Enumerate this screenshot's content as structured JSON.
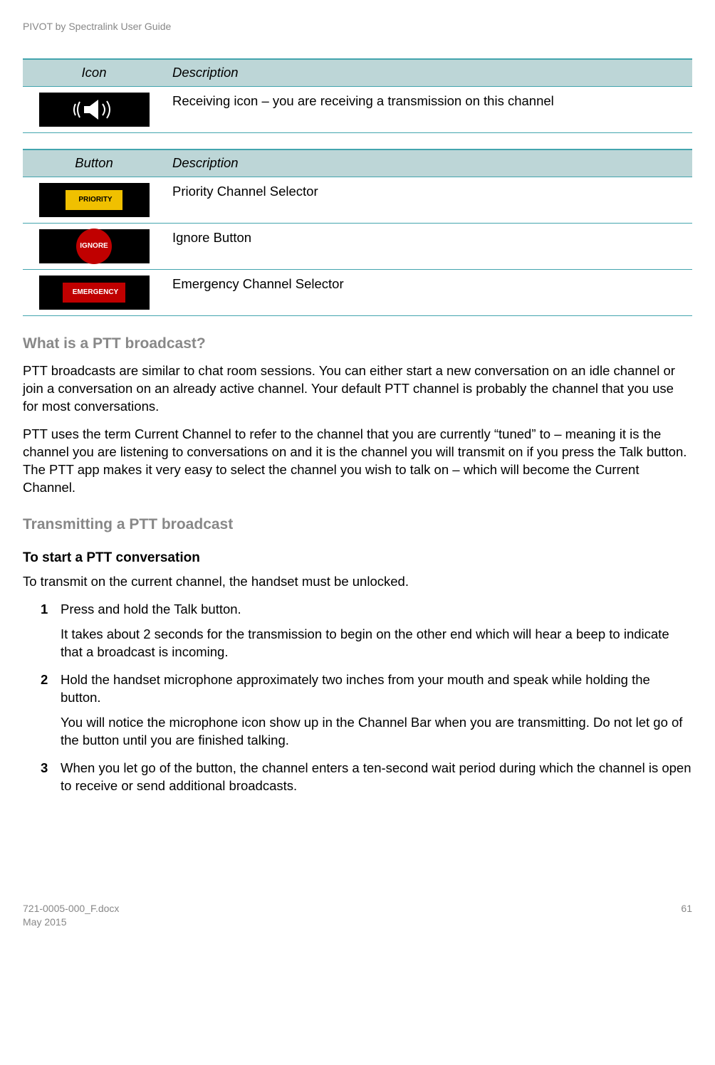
{
  "header": {
    "title": "PIVOT by Spectralink User Guide"
  },
  "table1": {
    "col1": "Icon",
    "col2": "Description",
    "rows": [
      {
        "desc": "Receiving icon – you are receiving a transmission on this channel"
      }
    ]
  },
  "table2": {
    "col1": "Button",
    "col2": "Description",
    "rows": [
      {
        "label": "PRIORITY",
        "desc": "Priority Channel Selector"
      },
      {
        "label": "IGNORE",
        "desc": "Ignore Button"
      },
      {
        "label": "EMERGENCY",
        "desc": "Emergency Channel Selector"
      }
    ]
  },
  "section1": {
    "heading": "What is a PTT broadcast?",
    "p1": "PTT broadcasts are similar to chat room sessions.  You can either start a new conversation on an idle channel or join a conversation on an already active channel.  Your default PTT channel is probably the channel that you use for most conversations.",
    "p2": "PTT uses the term Current Channel to refer to the channel that you are currently “tuned” to – meaning it is the channel you are listening to conversations on and it is the channel you will transmit on if you press the Talk button. The PTT app makes it very easy to select the channel you wish to talk on – which will become the Current Channel."
  },
  "section2": {
    "heading": "Transmitting a PTT broadcast",
    "sub": "To start a PTT conversation",
    "intro": "To transmit on the current channel, the handset must be unlocked.",
    "steps": [
      {
        "n": "1",
        "text": "Press and hold the Talk button.",
        "extra": "It takes about 2 seconds for the transmission to begin on the other end which will hear a beep to indicate that a broadcast is incoming."
      },
      {
        "n": "2",
        "text": "Hold the handset microphone approximately two inches from your mouth and speak while holding the button.",
        "extra": "You will notice the microphone icon show up in the Channel Bar when you are transmitting. Do not let go of the button until you are finished talking."
      },
      {
        "n": "3",
        "text": "When you let go of the button, the channel enters a ten-second wait period during which the channel is open to receive or send additional broadcasts."
      }
    ]
  },
  "footer": {
    "left1": "721-0005-000_F.docx",
    "left2": "May 2015",
    "page": "61"
  }
}
